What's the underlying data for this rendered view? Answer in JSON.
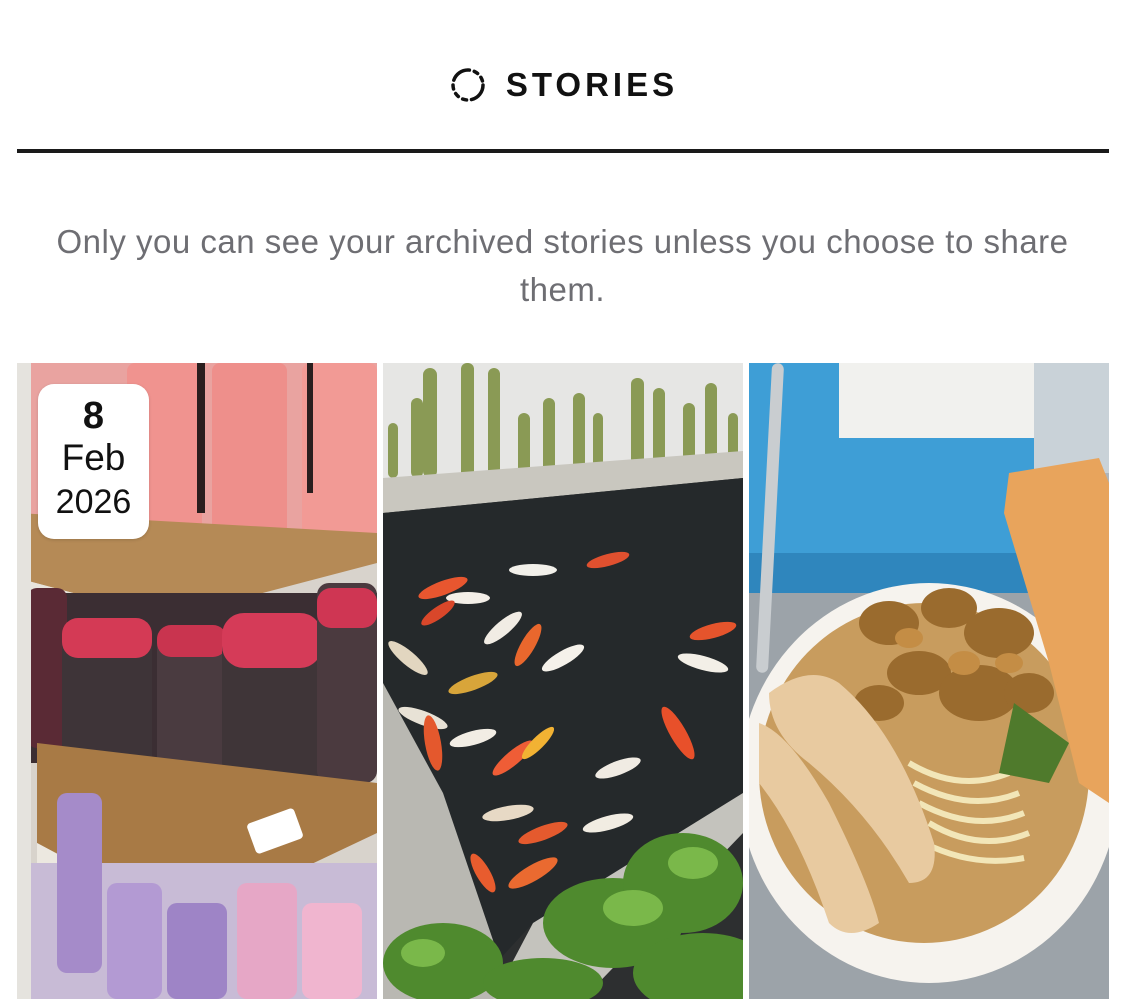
{
  "tabs": [
    {
      "label": "STORIES",
      "icon": "dashed-circle-icon",
      "active": true
    }
  ],
  "notice": "Only you can see your archived stories unless you choose to share them.",
  "stories": [
    {
      "thumbnail": "water-bottles-store-shelf",
      "date": {
        "day": "8",
        "month": "Feb",
        "year": "2026"
      }
    },
    {
      "thumbnail": "koi-pond-with-cacti"
    },
    {
      "thumbnail": "chicken-noodle-bowl"
    }
  ],
  "colors": {
    "tab_text": "#111111",
    "underline": "#1a1a1a",
    "notice_text": "#6e6e73",
    "background": "#ffffff"
  }
}
